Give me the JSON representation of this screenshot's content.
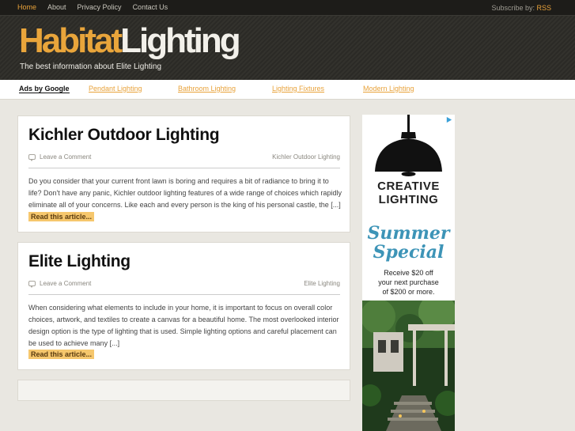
{
  "topnav": {
    "items": [
      {
        "label": "Home"
      },
      {
        "label": "About"
      },
      {
        "label": "Privacy Policy"
      },
      {
        "label": "Contact Us"
      }
    ],
    "subscribe_label": "Subscribe by:",
    "rss_label": "RSS"
  },
  "site": {
    "logo_part1": "Habitat",
    "logo_part2": "Lighting",
    "tagline": "The best information about Elite Lighting"
  },
  "adsbar": {
    "label": "Ads by Google",
    "links": [
      {
        "label": "Pendant Lighting"
      },
      {
        "label": "Bathroom Lighting"
      },
      {
        "label": "Lighting Fixtures"
      },
      {
        "label": "Modern Lighting"
      }
    ]
  },
  "posts": [
    {
      "title": "Kichler Outdoor Lighting",
      "comment_label": "Leave a Comment",
      "category": "Kichler Outdoor Lighting",
      "excerpt": "Do you consider that your current front lawn is boring and requires a bit of radiance to bring it to life? Don't have any panic, Kichler outdoor lighting features of a wide range of choices which rapidly eliminate all of your concerns. Like each and every person is the king of his personal castle, the [...]",
      "more_label": "Read this article..."
    },
    {
      "title": "Elite Lighting",
      "comment_label": "Leave a Comment",
      "category": "Elite Lighting",
      "excerpt": "When considering what elements to include in your home, it is important to focus on overall color choices, artwork, and textiles to create a canvas for a beautiful home. The most overlooked interior design option is the type of lighting that is used. Simple lighting options and careful placement can be used to achieve many [...]",
      "more_label": "Read this article..."
    }
  ],
  "sidead": {
    "brand_line1": "CREATIVE",
    "brand_line2": "LIGHTING",
    "promo_line1": "Summer",
    "promo_line2": "Special",
    "offer_line1": "Receive $20 off",
    "offer_line2": "your next purchase",
    "offer_line3": "of $200 or more."
  },
  "colors": {
    "accent": "#e8a23a",
    "header_bg": "#2b2a26",
    "promo_blue": "#3d94b7"
  }
}
